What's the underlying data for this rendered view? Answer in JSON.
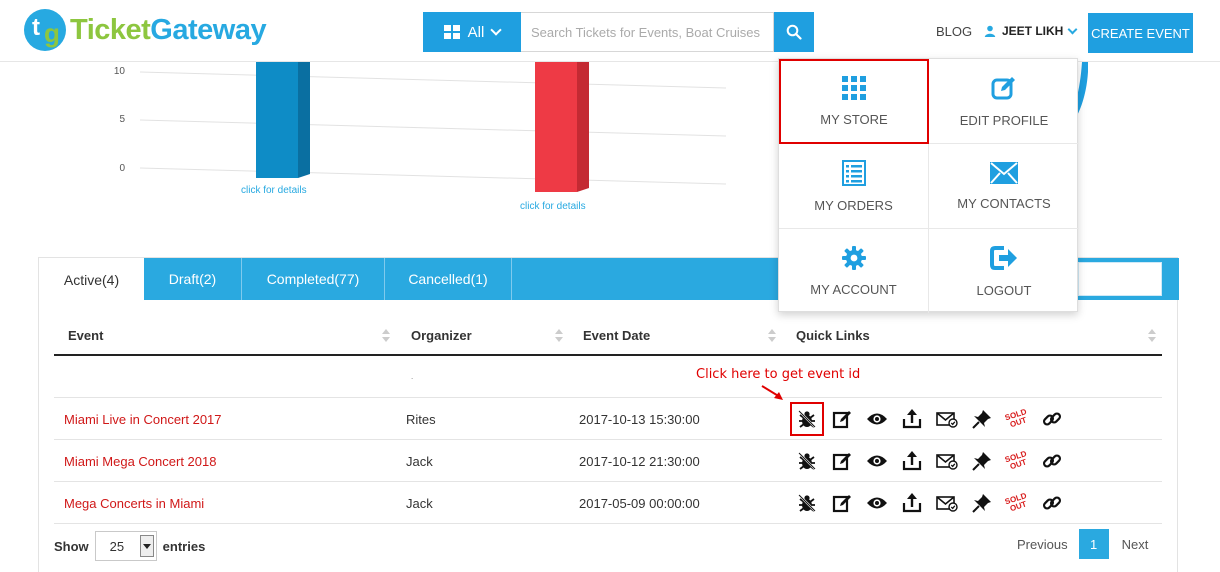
{
  "header": {
    "logo_a": "Ticket",
    "logo_b": "Gateway",
    "category_label": "All",
    "search_placeholder": "Search Tickets for Events, Boat Cruises",
    "blog_label": "BLOG",
    "user_name": "JEET LIKH",
    "create_event_label": "CREATE EVENT"
  },
  "chart": {
    "tick_labels": [
      "10",
      "5",
      "0"
    ],
    "bar_links": [
      "click for details",
      "click for details"
    ]
  },
  "user_dropdown": {
    "items": [
      {
        "label": "MY STORE",
        "icon": "grid-icon"
      },
      {
        "label": "EDIT PROFILE",
        "icon": "edit-icon"
      },
      {
        "label": "MY ORDERS",
        "icon": "list-icon"
      },
      {
        "label": "MY CONTACTS",
        "icon": "envelope-icon"
      },
      {
        "label": "MY ACCOUNT",
        "icon": "gear-icon"
      },
      {
        "label": "LOGOUT",
        "icon": "logout-icon"
      }
    ]
  },
  "tabs": [
    {
      "label": "Active(4)",
      "active": true
    },
    {
      "label": "Draft(2)",
      "active": false
    },
    {
      "label": "Completed(77)",
      "active": false
    },
    {
      "label": "Cancelled(1)",
      "active": false
    }
  ],
  "table": {
    "columns": [
      "Event",
      "Organizer",
      "Event Date",
      "Quick Links"
    ],
    "empty_row_mark": ".",
    "rows": [
      {
        "event": "Miami Live in Concert 2017",
        "organizer": "Rites",
        "date": "2017-10-13 15:30:00"
      },
      {
        "event": "Miami Mega Concert 2018",
        "organizer": "Jack",
        "date": "2017-10-12 21:30:00"
      },
      {
        "event": "Mega Concerts in Miami",
        "organizer": "Jack",
        "date": "2017-05-09 00:00:00"
      }
    ],
    "quick_link_icons": [
      "bug-icon",
      "edit-icon",
      "eye-icon",
      "upload-icon",
      "mail-icon",
      "pin-icon",
      "sold-out-icon",
      "link-icon"
    ],
    "sold_out_text": [
      "SOLD",
      "OUT"
    ]
  },
  "annotation": "Click here to get event id",
  "footer": {
    "show_label": "Show",
    "entries_value": "25",
    "entries_label": "entries",
    "previous_label": "Previous",
    "page_number": "1",
    "next_label": "Next"
  },
  "colors": {
    "accent": "#27a9e1",
    "brand_green": "#8dc63f",
    "event_link": "#d01818",
    "highlight": "#e00000"
  }
}
